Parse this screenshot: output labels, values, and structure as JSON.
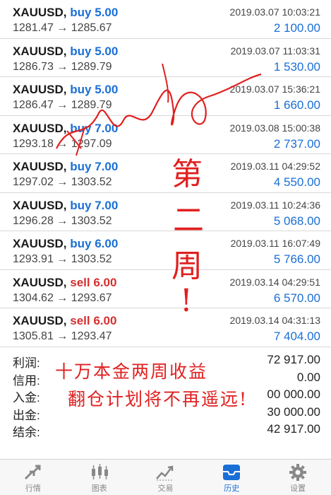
{
  "trades": [
    {
      "symbol": "XAUUSD",
      "direction": "buy",
      "lots": "5.00",
      "open": "1281.47",
      "close": "1285.67",
      "time": "2019.03.07 10:03:21",
      "profit": "2 100.00"
    },
    {
      "symbol": "XAUUSD",
      "direction": "buy",
      "lots": "5.00",
      "open": "1286.73",
      "close": "1289.79",
      "time": "2019.03.07 11:03:31",
      "profit": "1 530.00"
    },
    {
      "symbol": "XAUUSD",
      "direction": "buy",
      "lots": "5.00",
      "open": "1286.47",
      "close": "1289.79",
      "time": "2019.03.07 15:36:21",
      "profit": "1 660.00"
    },
    {
      "symbol": "XAUUSD",
      "direction": "buy",
      "lots": "7.00",
      "open": "1293.18",
      "close": "1297.09",
      "time": "2019.03.08 15:00:38",
      "profit": "2 737.00"
    },
    {
      "symbol": "XAUUSD",
      "direction": "buy",
      "lots": "7.00",
      "open": "1297.02",
      "close": "1303.52",
      "time": "2019.03.11 04:29:52",
      "profit": "4 550.00"
    },
    {
      "symbol": "XAUUSD",
      "direction": "buy",
      "lots": "7.00",
      "open": "1296.28",
      "close": "1303.52",
      "time": "2019.03.11 10:24:36",
      "profit": "5 068.00"
    },
    {
      "symbol": "XAUUSD",
      "direction": "buy",
      "lots": "6.00",
      "open": "1293.91",
      "close": "1303.52",
      "time": "2019.03.11 16:07:49",
      "profit": "5 766.00"
    },
    {
      "symbol": "XAUUSD",
      "direction": "sell",
      "lots": "6.00",
      "open": "1304.62",
      "close": "1293.67",
      "time": "2019.03.14 04:29:51",
      "profit": "6 570.00"
    },
    {
      "symbol": "XAUUSD",
      "direction": "sell",
      "lots": "6.00",
      "open": "1305.81",
      "close": "1293.47",
      "time": "2019.03.14 04:31:13",
      "profit": "7 404.00"
    }
  ],
  "summary": {
    "profit_label": "利润:",
    "profit_value": "72 917.00",
    "credit_label": "信用:",
    "credit_value": "0.00",
    "deposit_label": "入金:",
    "deposit_value": "00 000.00",
    "withdraw_label": "出金:",
    "withdraw_value": "30 000.00",
    "balance_label": "结余:",
    "balance_value": "42 917.00"
  },
  "annotations": {
    "line1": "十万本金两周收益",
    "line2": "翻仓计划将不再遥远!",
    "vertical": [
      "第",
      "二",
      "周",
      "!"
    ]
  },
  "tabs": [
    {
      "label": "行情",
      "icon": "quotes-icon"
    },
    {
      "label": "图表",
      "icon": "chart-icon"
    },
    {
      "label": "交易",
      "icon": "trade-icon"
    },
    {
      "label": "历史",
      "icon": "history-icon",
      "active": true
    },
    {
      "label": "设置",
      "icon": "settings-icon"
    }
  ],
  "colors": {
    "buy": "#1a6fd6",
    "sell": "#d63030",
    "annotation": "#e02020",
    "active_tab": "#1a6fd6"
  }
}
